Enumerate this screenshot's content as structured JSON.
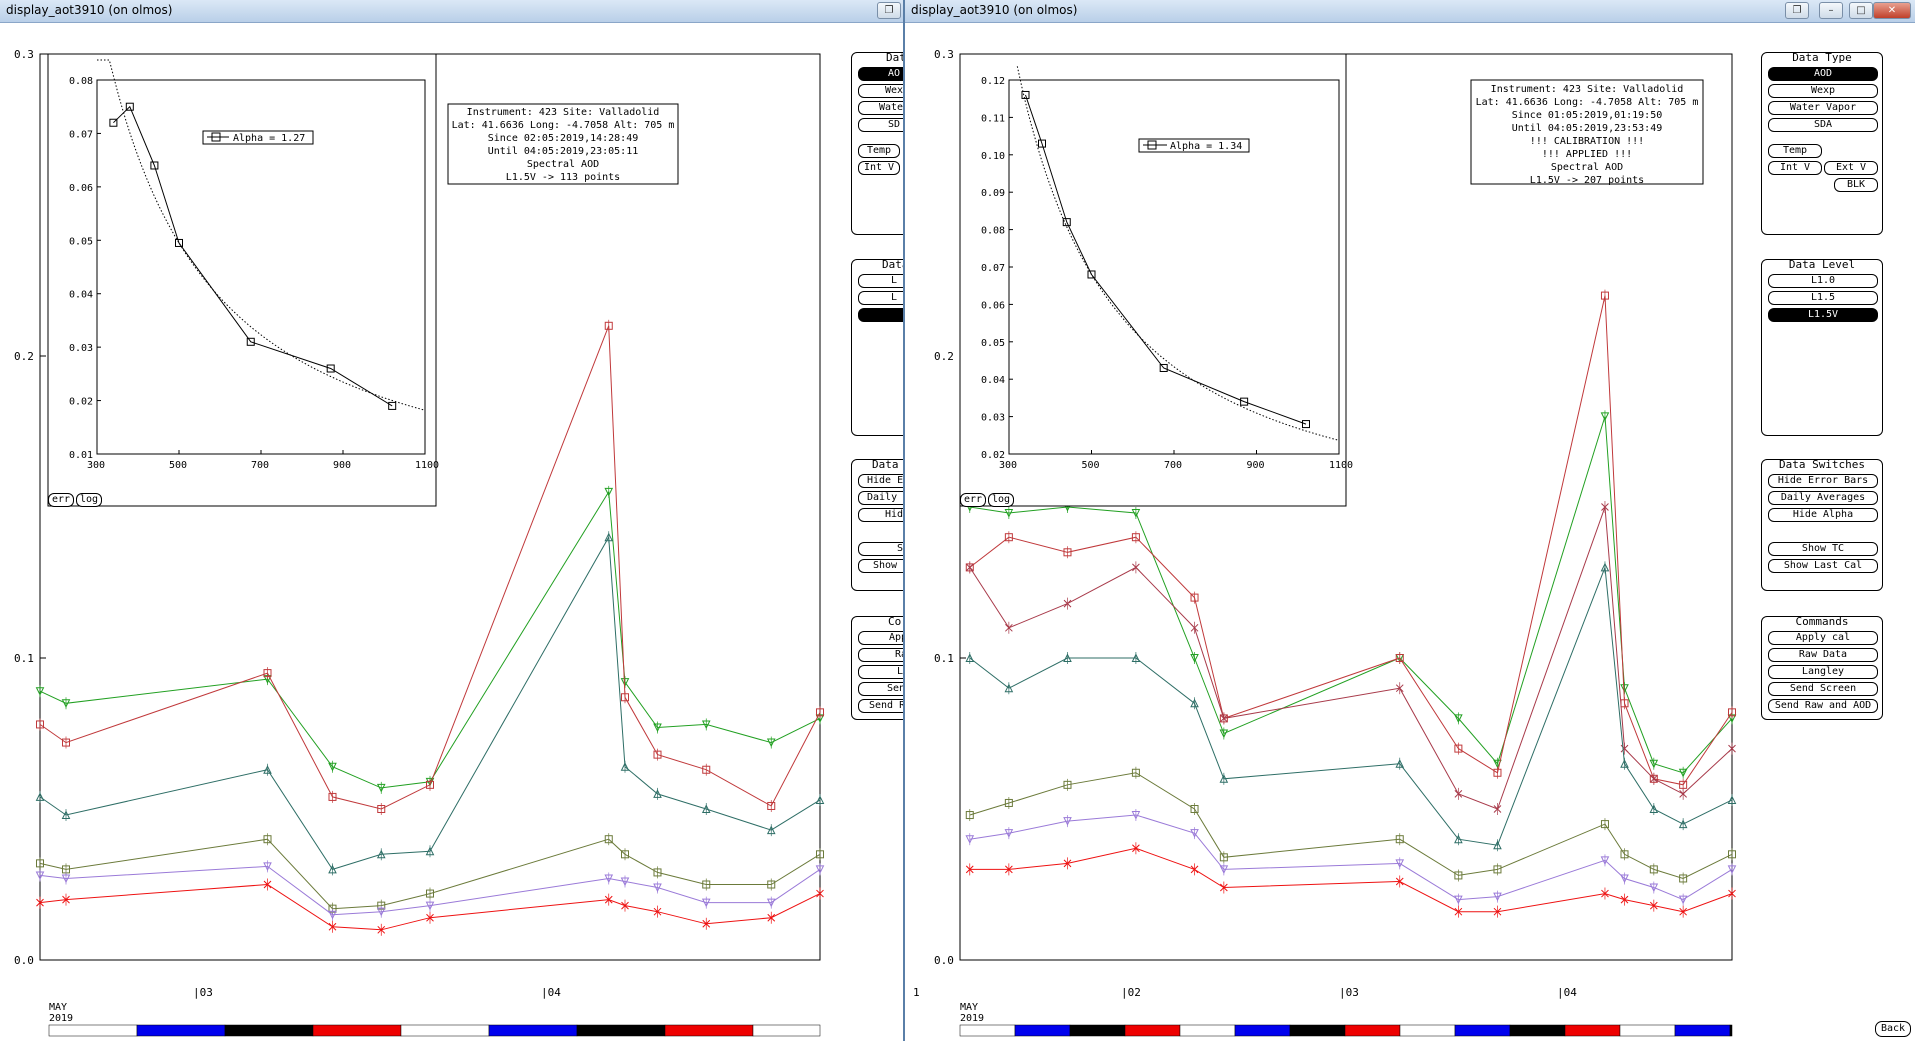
{
  "left": {
    "title": "display_aot3910 (on olmos)",
    "info": [
      "Instrument: 423 Site: Valladolid",
      "Lat: 41.6636 Long: -4.7058 Alt: 705 m",
      "Since 02:05:2019,14:28:49",
      "Until 04:05:2019,23:05:11",
      "Spectral AOD",
      "L1.5V -> 113 points"
    ],
    "alpha": "Alpha = 1.27",
    "yticks": [
      "0.3",
      "0.2",
      "0.1",
      "0.0"
    ],
    "xdays": [
      "|03",
      "|04"
    ],
    "month": "MAY",
    "year": "2019",
    "inset_yticks": [
      "0.08",
      "0.07",
      "0.06",
      "0.05",
      "0.04",
      "0.03",
      "0.02",
      "0.01"
    ],
    "inset_xticks": [
      "300",
      "500",
      "700",
      "900",
      "1100"
    ],
    "err": "err",
    "log": "log",
    "panels": {
      "data_type": {
        "title": "Dat",
        "buttons": [
          "AO",
          "Wex",
          "Water",
          "SD",
          "Temp",
          "Int V"
        ]
      },
      "data_level": {
        "title": "Data",
        "buttons": [
          "L",
          "L",
          "L"
        ]
      },
      "switches": {
        "title": "Data",
        "buttons": [
          "Hide E",
          "Daily",
          "Hide",
          "Sh",
          "Show"
        ]
      },
      "commands": {
        "title": "Co",
        "buttons": [
          "App",
          "Ra",
          "La",
          "Send",
          "Send Ra"
        ]
      }
    }
  },
  "right": {
    "title": "display_aot3910 (on olmos)",
    "info": [
      "Instrument: 423 Site: Valladolid",
      "Lat: 41.6636 Long: -4.7058 Alt: 705 m",
      "Since 01:05:2019,01:19:50",
      "Until 04:05:2019,23:53:49",
      "!!! CALIBRATION !!!",
      "!!!  APPLIED  !!!",
      "Spectral AOD",
      "L1.5V -> 207 points"
    ],
    "alpha": "Alpha = 1.34",
    "yticks": [
      "0.3",
      "0.2",
      "0.1",
      "0.0"
    ],
    "xdays": [
      "1",
      "|02",
      "|03",
      "|04"
    ],
    "month": "MAY",
    "year": "2019",
    "inset_yticks": [
      "0.12",
      "0.11",
      "0.10",
      "0.09",
      "0.08",
      "0.07",
      "0.06",
      "0.05",
      "0.04",
      "0.03",
      "0.02"
    ],
    "inset_xticks": [
      "300",
      "500",
      "700",
      "900",
      "1100"
    ],
    "err": "err",
    "log": "log",
    "back": "Back",
    "panels": {
      "data_type": {
        "title": "Data Type",
        "buttons": [
          "AOD",
          "Wexp",
          "Water Vapor",
          "SDA",
          "Temp",
          "Int V",
          "Ext V",
          "BLK"
        ]
      },
      "data_level": {
        "title": "Data Level",
        "buttons": [
          "L1.0",
          "L1.5",
          "L1.5V"
        ]
      },
      "switches": {
        "title": "Data Switches",
        "buttons": [
          "Hide Error Bars",
          "Daily Averages",
          "Hide Alpha",
          "Show TC",
          "Show Last Cal"
        ]
      },
      "commands": {
        "title": "Commands",
        "buttons": [
          "Apply cal",
          "Raw Data",
          "Langley",
          "Send Screen",
          "Send Raw and AOD"
        ]
      }
    }
  },
  "chart_data": [
    {
      "type": "line",
      "title": "",
      "xlabel": "Wavelength",
      "ylabel": "AOD",
      "x": [
        340,
        380,
        440,
        500,
        675,
        870,
        1020
      ],
      "series": [
        {
          "values": [
            0.072,
            0.075,
            0.064,
            0.0495,
            0.031,
            0.026,
            0.019
          ]
        }
      ],
      "xlim": [
        300,
        1100
      ],
      "ylim": [
        0.01,
        0.08
      ],
      "legend": "Alpha = 1.27"
    },
    {
      "type": "line",
      "title": "",
      "xlabel": "Wavelength",
      "ylabel": "AOD",
      "x": [
        340,
        380,
        440,
        500,
        675,
        870,
        1020
      ],
      "series": [
        {
          "values": [
            0.116,
            0.103,
            0.082,
            0.068,
            0.043,
            0.034,
            0.028
          ]
        }
      ],
      "xlim": [
        300,
        1100
      ],
      "ylim": [
        0.02,
        0.12
      ],
      "legend": "Alpha = 1.34"
    },
    {
      "type": "scatter",
      "title": "",
      "xlabel": "",
      "ylabel": "",
      "x_unit": "day of May 2019",
      "ylim": [
        0.0,
        0.3
      ],
      "xlim": [
        2.55,
        4.95
      ],
      "series": [
        {
          "color": "#22a022",
          "marker": "triangle-down",
          "points": [
            [
              2.55,
              0.089
            ],
            [
              2.63,
              0.085
            ],
            [
              3.25,
              0.093
            ],
            [
              3.45,
              0.064
            ],
            [
              3.6,
              0.057
            ],
            [
              3.75,
              0.059
            ],
            [
              4.3,
              0.155
            ],
            [
              4.35,
              0.092
            ],
            [
              4.45,
              0.077
            ],
            [
              4.6,
              0.078
            ],
            [
              4.8,
              0.072
            ],
            [
              4.95,
              0.08
            ]
          ]
        },
        {
          "color": "#c0393b",
          "marker": "square",
          "points": [
            [
              2.55,
              0.078
            ],
            [
              2.63,
              0.072
            ],
            [
              3.25,
              0.095
            ],
            [
              3.45,
              0.054
            ],
            [
              3.6,
              0.05
            ],
            [
              3.75,
              0.058
            ],
            [
              4.3,
              0.21
            ],
            [
              4.35,
              0.087
            ],
            [
              4.45,
              0.068
            ],
            [
              4.6,
              0.063
            ],
            [
              4.8,
              0.051
            ],
            [
              4.95,
              0.082
            ]
          ]
        },
        {
          "color": "#2e6e66",
          "marker": "triangle-up",
          "points": [
            [
              2.55,
              0.054
            ],
            [
              2.63,
              0.048
            ],
            [
              3.25,
              0.063
            ],
            [
              3.45,
              0.03
            ],
            [
              3.6,
              0.035
            ],
            [
              3.75,
              0.036
            ],
            [
              4.3,
              0.14
            ],
            [
              4.35,
              0.064
            ],
            [
              4.45,
              0.055
            ],
            [
              4.6,
              0.05
            ],
            [
              4.8,
              0.043
            ],
            [
              4.95,
              0.053
            ]
          ]
        },
        {
          "color": "#6b7a3a",
          "marker": "square",
          "points": [
            [
              2.55,
              0.032
            ],
            [
              2.63,
              0.03
            ],
            [
              3.25,
              0.04
            ],
            [
              3.45,
              0.017
            ],
            [
              3.6,
              0.018
            ],
            [
              3.75,
              0.022
            ],
            [
              4.3,
              0.04
            ],
            [
              4.35,
              0.035
            ],
            [
              4.45,
              0.029
            ],
            [
              4.6,
              0.025
            ],
            [
              4.8,
              0.025
            ],
            [
              4.95,
              0.035
            ]
          ]
        },
        {
          "color": "#9a7ad8",
          "marker": "triangle-down",
          "points": [
            [
              2.55,
              0.028
            ],
            [
              2.63,
              0.027
            ],
            [
              3.25,
              0.031
            ],
            [
              3.45,
              0.015
            ],
            [
              3.6,
              0.016
            ],
            [
              3.75,
              0.018
            ],
            [
              4.3,
              0.027
            ],
            [
              4.35,
              0.026
            ],
            [
              4.45,
              0.024
            ],
            [
              4.6,
              0.019
            ],
            [
              4.8,
              0.019
            ],
            [
              4.95,
              0.03
            ]
          ]
        },
        {
          "color": "#ee1111",
          "marker": "x",
          "points": [
            [
              2.55,
              0.019
            ],
            [
              2.63,
              0.02
            ],
            [
              3.25,
              0.025
            ],
            [
              3.45,
              0.011
            ],
            [
              3.6,
              0.01
            ],
            [
              3.75,
              0.014
            ],
            [
              4.3,
              0.02
            ],
            [
              4.35,
              0.018
            ],
            [
              4.45,
              0.016
            ],
            [
              4.6,
              0.012
            ],
            [
              4.8,
              0.014
            ],
            [
              4.95,
              0.022
            ]
          ]
        }
      ]
    },
    {
      "type": "scatter",
      "title": "",
      "xlabel": "",
      "ylabel": "",
      "x_unit": "day of May 2019",
      "ylim": [
        0.0,
        0.3
      ],
      "xlim": [
        1.0,
        4.95
      ],
      "series": [
        {
          "color": "#22a022",
          "marker": "triangle-down",
          "points": [
            [
              1.05,
              0.15
            ],
            [
              1.25,
              0.148
            ],
            [
              1.55,
              0.15
            ],
            [
              1.9,
              0.148
            ],
            [
              2.2,
              0.1
            ],
            [
              2.35,
              0.075
            ],
            [
              3.25,
              0.1
            ],
            [
              3.55,
              0.08
            ],
            [
              3.75,
              0.065
            ],
            [
              4.3,
              0.18
            ],
            [
              4.4,
              0.09
            ],
            [
              4.55,
              0.065
            ],
            [
              4.7,
              0.062
            ],
            [
              4.95,
              0.08
            ]
          ]
        },
        {
          "color": "#c0393b",
          "marker": "square",
          "points": [
            [
              1.05,
              0.13
            ],
            [
              1.25,
              0.14
            ],
            [
              1.55,
              0.135
            ],
            [
              1.9,
              0.14
            ],
            [
              2.2,
              0.12
            ],
            [
              2.35,
              0.08
            ],
            [
              3.25,
              0.1
            ],
            [
              3.55,
              0.07
            ],
            [
              3.75,
              0.062
            ],
            [
              4.3,
              0.22
            ],
            [
              4.4,
              0.085
            ],
            [
              4.55,
              0.06
            ],
            [
              4.7,
              0.058
            ],
            [
              4.95,
              0.082
            ]
          ]
        },
        {
          "color": "#a83a4a",
          "marker": "x",
          "points": [
            [
              1.05,
              0.13
            ],
            [
              1.25,
              0.11
            ],
            [
              1.55,
              0.118
            ],
            [
              1.9,
              0.13
            ],
            [
              2.2,
              0.11
            ],
            [
              2.35,
              0.08
            ],
            [
              3.25,
              0.09
            ],
            [
              3.55,
              0.055
            ],
            [
              3.75,
              0.05
            ],
            [
              4.3,
              0.15
            ],
            [
              4.4,
              0.07
            ],
            [
              4.55,
              0.06
            ],
            [
              4.7,
              0.055
            ],
            [
              4.95,
              0.07
            ]
          ]
        },
        {
          "color": "#2e6e66",
          "marker": "triangle-up",
          "points": [
            [
              1.05,
              0.1
            ],
            [
              1.25,
              0.09
            ],
            [
              1.55,
              0.1
            ],
            [
              1.9,
              0.1
            ],
            [
              2.2,
              0.085
            ],
            [
              2.35,
              0.06
            ],
            [
              3.25,
              0.065
            ],
            [
              3.55,
              0.04
            ],
            [
              3.75,
              0.038
            ],
            [
              4.3,
              0.13
            ],
            [
              4.4,
              0.065
            ],
            [
              4.55,
              0.05
            ],
            [
              4.7,
              0.045
            ],
            [
              4.95,
              0.053
            ]
          ]
        },
        {
          "color": "#6b7a3a",
          "marker": "square",
          "points": [
            [
              1.05,
              0.048
            ],
            [
              1.25,
              0.052
            ],
            [
              1.55,
              0.058
            ],
            [
              1.9,
              0.062
            ],
            [
              2.2,
              0.05
            ],
            [
              2.35,
              0.034
            ],
            [
              3.25,
              0.04
            ],
            [
              3.55,
              0.028
            ],
            [
              3.75,
              0.03
            ],
            [
              4.3,
              0.045
            ],
            [
              4.4,
              0.035
            ],
            [
              4.55,
              0.03
            ],
            [
              4.7,
              0.027
            ],
            [
              4.95,
              0.035
            ]
          ]
        },
        {
          "color": "#9a7ad8",
          "marker": "triangle-down",
          "points": [
            [
              1.05,
              0.04
            ],
            [
              1.25,
              0.042
            ],
            [
              1.55,
              0.046
            ],
            [
              1.9,
              0.048
            ],
            [
              2.2,
              0.042
            ],
            [
              2.35,
              0.03
            ],
            [
              3.25,
              0.032
            ],
            [
              3.55,
              0.02
            ],
            [
              3.75,
              0.021
            ],
            [
              4.3,
              0.033
            ],
            [
              4.4,
              0.027
            ],
            [
              4.55,
              0.024
            ],
            [
              4.7,
              0.02
            ],
            [
              4.95,
              0.03
            ]
          ]
        },
        {
          "color": "#ee1111",
          "marker": "x",
          "points": [
            [
              1.05,
              0.03
            ],
            [
              1.25,
              0.03
            ],
            [
              1.55,
              0.032
            ],
            [
              1.9,
              0.037
            ],
            [
              2.2,
              0.03
            ],
            [
              2.35,
              0.024
            ],
            [
              3.25,
              0.026
            ],
            [
              3.55,
              0.016
            ],
            [
              3.75,
              0.016
            ],
            [
              4.3,
              0.022
            ],
            [
              4.4,
              0.02
            ],
            [
              4.55,
              0.018
            ],
            [
              4.7,
              0.016
            ],
            [
              4.95,
              0.022
            ]
          ]
        }
      ]
    }
  ]
}
